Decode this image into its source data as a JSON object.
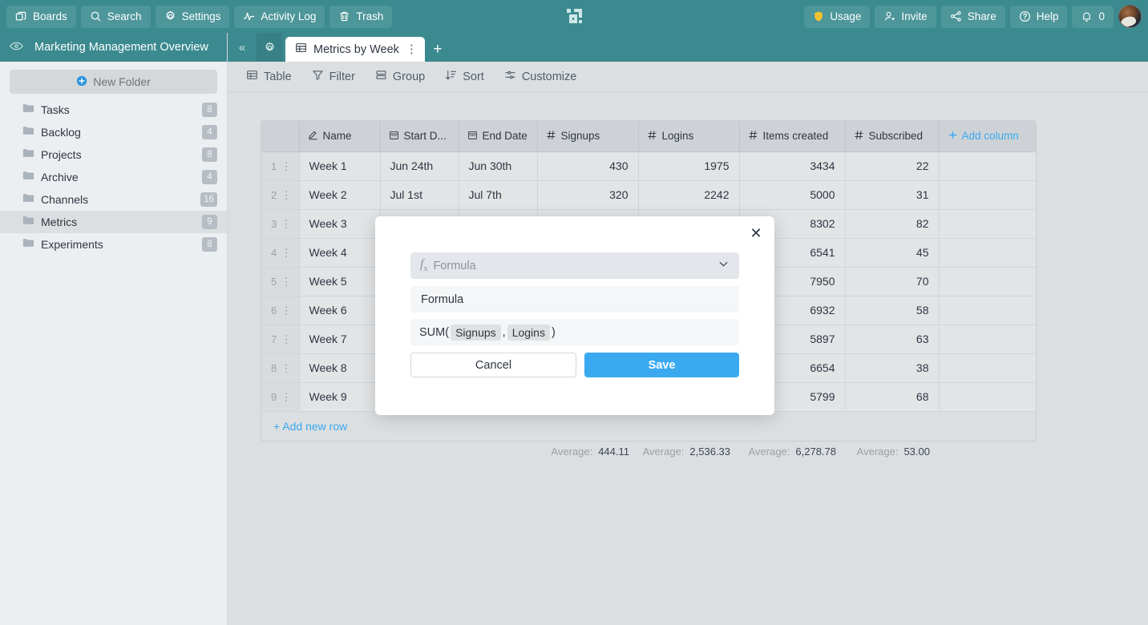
{
  "topbar": {
    "left_buttons": [
      {
        "label": "Boards",
        "icon": "boards-icon"
      },
      {
        "label": "Search",
        "icon": "search-icon"
      },
      {
        "label": "Settings",
        "icon": "gear-icon"
      },
      {
        "label": "Activity Log",
        "icon": "activity-icon"
      },
      {
        "label": "Trash",
        "icon": "trash-icon"
      }
    ],
    "right_buttons": [
      {
        "label": "Usage",
        "icon": "shield-icon"
      },
      {
        "label": "Invite",
        "icon": "user-add-icon"
      },
      {
        "label": "Share",
        "icon": "share-icon"
      },
      {
        "label": "Help",
        "icon": "question-circle-icon"
      },
      {
        "label": "0",
        "icon": "bell-icon"
      }
    ],
    "logo": "pixel-logo",
    "avatar": "user-avatar",
    "bg_color": "#3b8a8f",
    "button_bg_color": "#4d969a",
    "usage_icon_color": "#f2c230"
  },
  "sidebar": {
    "title": "Marketing Management Overview",
    "eye_icon": "eye-icon",
    "new_folder_label": "New Folder",
    "folders": [
      {
        "label": "Tasks",
        "count": "8"
      },
      {
        "label": "Backlog",
        "count": "4"
      },
      {
        "label": "Projects",
        "count": "8"
      },
      {
        "label": "Archive",
        "count": "4"
      },
      {
        "label": "Channels",
        "count": "16"
      },
      {
        "label": "Metrics",
        "count": "9"
      },
      {
        "label": "Experiments",
        "count": "8"
      }
    ],
    "active_index": 5
  },
  "tabstrip": {
    "collapse_label": "«",
    "gear_icon": "gear-icon",
    "active_tab": {
      "label": "Metrics by Week",
      "icon": "table-icon",
      "menu": "⋮"
    },
    "add_tab_label": "+"
  },
  "viewbar": {
    "buttons": [
      {
        "label": "Table",
        "icon": "table-icon"
      },
      {
        "label": "Filter",
        "icon": "filter-icon"
      },
      {
        "label": "Group",
        "icon": "group-icon"
      },
      {
        "label": "Sort",
        "icon": "sort-icon"
      },
      {
        "label": "Customize",
        "icon": "sliders-icon"
      }
    ]
  },
  "table": {
    "columns": [
      {
        "label": "Name",
        "icon": "pencil-underline-icon"
      },
      {
        "label": "Start D...",
        "icon": "calendar-icon"
      },
      {
        "label": "End Date",
        "icon": "calendar-icon"
      },
      {
        "label": "Signups",
        "icon": "hash-icon"
      },
      {
        "label": "Logins",
        "icon": "hash-icon"
      },
      {
        "label": "Items created",
        "icon": "hash-icon"
      },
      {
        "label": "Subscribed",
        "icon": "hash-icon"
      }
    ],
    "add_column_label": "Add column",
    "add_column_icon": "plus-icon",
    "rows": [
      {
        "n": "1",
        "name": "Week 1",
        "start": "Jun 24th",
        "end": "Jun 30th",
        "signups": "430",
        "logins": "1975",
        "items": "3434",
        "subscribed": "22"
      },
      {
        "n": "2",
        "name": "Week 2",
        "start": "Jul 1st",
        "end": "Jul 7th",
        "signups": "320",
        "logins": "2242",
        "items": "5000",
        "subscribed": "31"
      },
      {
        "n": "3",
        "name": "Week 3",
        "start": "",
        "end": "",
        "signups": "",
        "logins": "",
        "items": "8302",
        "subscribed": "82"
      },
      {
        "n": "4",
        "name": "Week 4",
        "start": "",
        "end": "",
        "signups": "",
        "logins": "",
        "items": "6541",
        "subscribed": "45"
      },
      {
        "n": "5",
        "name": "Week 5",
        "start": "",
        "end": "",
        "signups": "",
        "logins": "",
        "items": "7950",
        "subscribed": "70"
      },
      {
        "n": "6",
        "name": "Week 6",
        "start": "",
        "end": "",
        "signups": "",
        "logins": "",
        "items": "6932",
        "subscribed": "58"
      },
      {
        "n": "7",
        "name": "Week 7",
        "start": "",
        "end": "",
        "signups": "",
        "logins": "",
        "items": "5897",
        "subscribed": "63"
      },
      {
        "n": "8",
        "name": "Week 8",
        "start": "",
        "end": "",
        "signups": "",
        "logins": "",
        "items": "6654",
        "subscribed": "38"
      },
      {
        "n": "9",
        "name": "Week 9",
        "start": "",
        "end": "",
        "signups": "",
        "logins": "",
        "items": "5799",
        "subscribed": "68"
      }
    ],
    "add_row_label": "+ Add new row",
    "averages": [
      {
        "label": "Average:",
        "value": "444.11"
      },
      {
        "label": "Average:",
        "value": "2,536.33"
      },
      {
        "label": "Average:",
        "value": "6,278.78"
      },
      {
        "label": "Average:",
        "value": "53.00"
      }
    ]
  },
  "modal": {
    "close_icon": "close-icon",
    "type_select": {
      "value": "Formula",
      "icon": "fx-icon",
      "chevron": "chevron-down-icon"
    },
    "name_field": {
      "value": "Formula"
    },
    "formula_field": {
      "prefix": "SUM(",
      "tokens": [
        "Signups",
        "Logins"
      ],
      "separator": ",",
      "suffix": ")"
    },
    "cancel_label": "Cancel",
    "save_label": "Save",
    "save_color": "#3ba9f0"
  }
}
